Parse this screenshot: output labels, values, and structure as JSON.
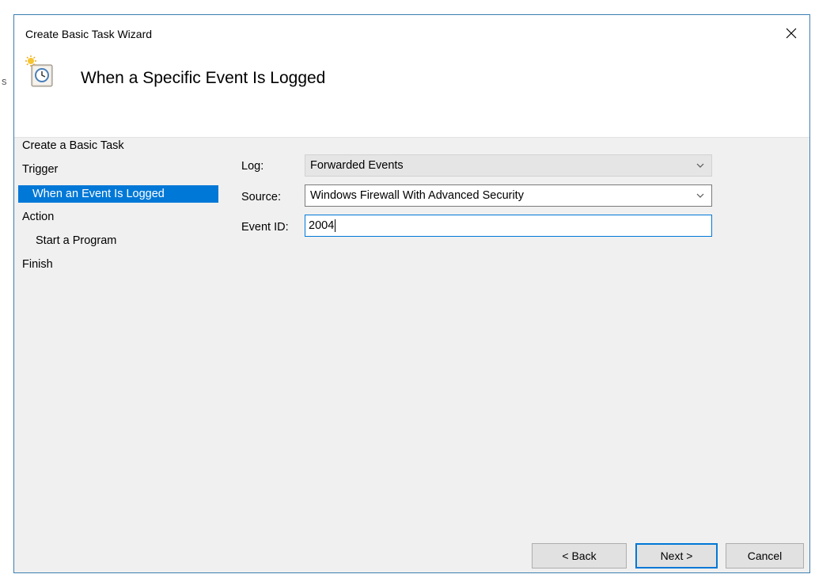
{
  "background_window": {
    "fragment": "s"
  },
  "dialog": {
    "title": "Create Basic Task Wizard",
    "header_title": "When a Specific Event Is Logged"
  },
  "nav": [
    {
      "label": "Create a Basic Task",
      "selected": false
    },
    {
      "label": "Trigger",
      "selected": false
    },
    {
      "label": "When an Event Is Logged",
      "selected": true
    },
    {
      "label": "Action",
      "selected": false
    },
    {
      "label": "Start a Program",
      "selected": false
    },
    {
      "label": "Finish",
      "selected": false
    }
  ],
  "form": {
    "log": {
      "label": "Log:",
      "value": "Forwarded Events"
    },
    "source": {
      "label": "Source:",
      "value": "Windows Firewall With Advanced Security"
    },
    "event_id": {
      "label": "Event ID:",
      "value": "2004"
    }
  },
  "buttons": {
    "back": "< Back",
    "next": "Next >",
    "cancel": "Cancel"
  },
  "colors": {
    "accent": "#0078d7",
    "content_bg": "#f0f0f0",
    "border": "#3c7fb1"
  },
  "icons": {
    "close": "close-icon",
    "task": "scheduled-task-clock-icon",
    "chevron": "chevron-down-icon"
  }
}
